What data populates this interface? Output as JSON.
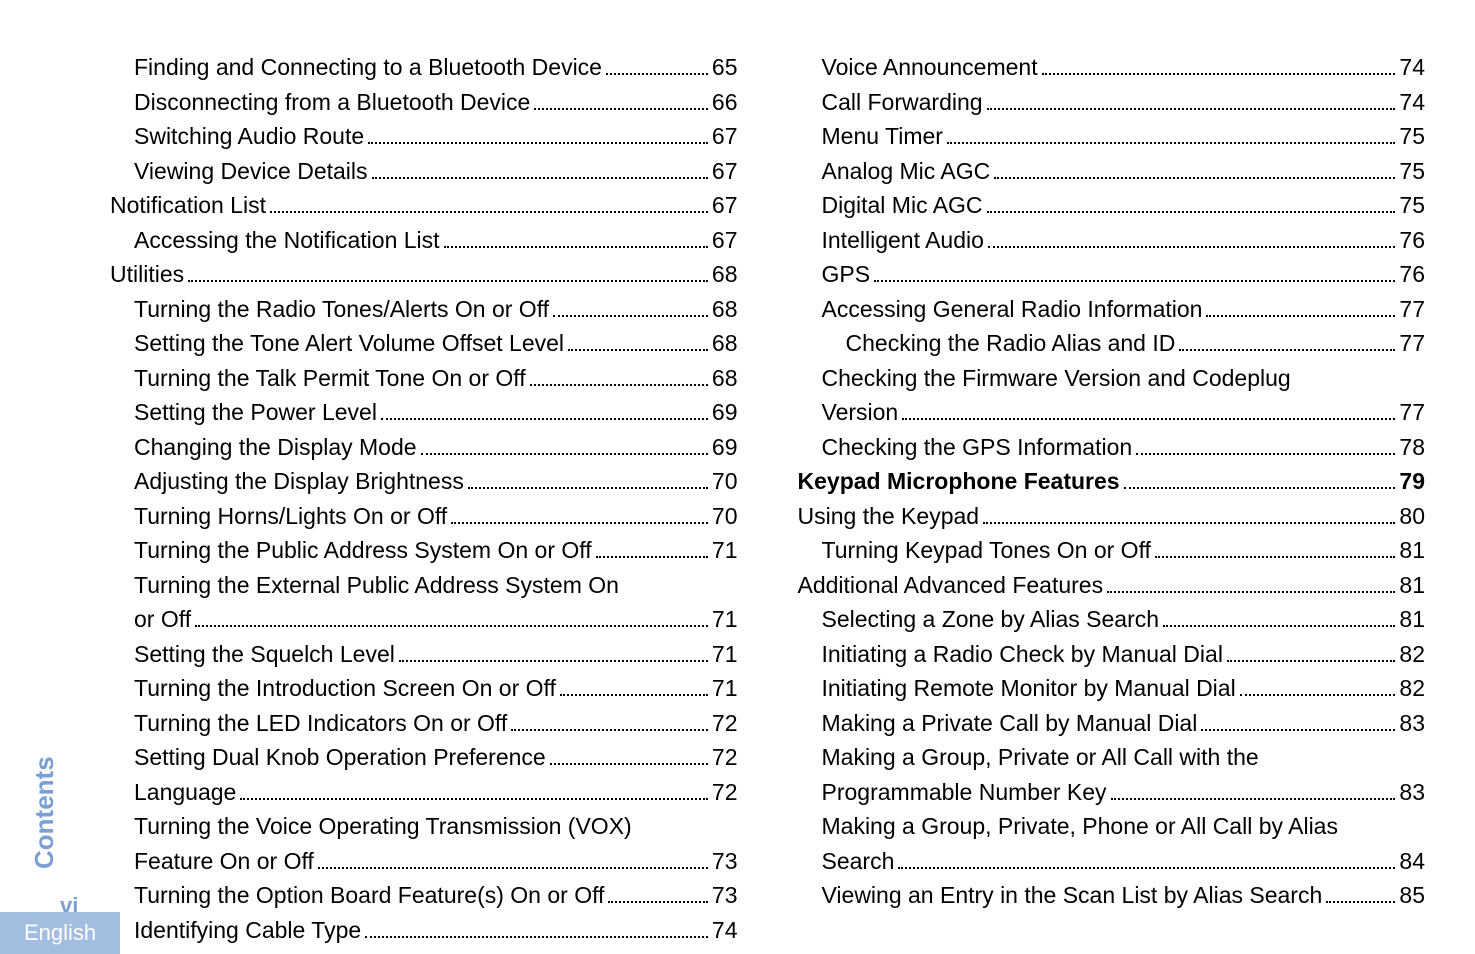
{
  "sidebar_label": "Contents",
  "page_number": "vi",
  "language": "English",
  "left_column": [
    {
      "label": "Finding and Connecting to a Bluetooth Device",
      "page": "65",
      "indent": 1
    },
    {
      "label": "Disconnecting from a Bluetooth Device",
      "page": "66",
      "indent": 1
    },
    {
      "label": "Switching Audio Route",
      "page": "67",
      "indent": 1
    },
    {
      "label": "Viewing Device Details",
      "page": "67",
      "indent": 1
    },
    {
      "label": "Notification List",
      "page": "67",
      "indent": 0
    },
    {
      "label": "Accessing the Notification List",
      "page": "67",
      "indent": 1
    },
    {
      "label": "Utilities",
      "page": "68",
      "indent": 0
    },
    {
      "label": "Turning the Radio Tones/Alerts On or Off",
      "page": "68",
      "indent": 1
    },
    {
      "label": "Setting the Tone Alert Volume Offset Level",
      "page": "68",
      "indent": 1
    },
    {
      "label": "Turning the Talk Permit Tone On or Off",
      "page": "68",
      "indent": 1
    },
    {
      "label": "Setting the Power Level",
      "page": "69",
      "indent": 1
    },
    {
      "label": "Changing the Display Mode",
      "page": "69",
      "indent": 1
    },
    {
      "label": "Adjusting the Display Brightness",
      "page": "70",
      "indent": 1
    },
    {
      "label": "Turning Horns/Lights On or Off",
      "page": "70",
      "indent": 1
    },
    {
      "label": "Turning the Public Address System On or Off",
      "page": "71",
      "indent": 1
    },
    {
      "label_wrap_pre": "Turning the External Public Address System On",
      "label": "or Off",
      "page": "71",
      "indent": 1
    },
    {
      "label": "Setting the Squelch Level",
      "page": "71",
      "indent": 1
    },
    {
      "label": "Turning the Introduction Screen On or Off",
      "page": "71",
      "indent": 1
    },
    {
      "label": "Turning the LED Indicators On or Off",
      "page": "72",
      "indent": 1
    },
    {
      "label": "Setting Dual Knob Operation Preference",
      "page": "72",
      "indent": 1
    },
    {
      "label": "Language",
      "page": "72",
      "indent": 1
    },
    {
      "label_wrap_pre": "Turning the Voice Operating Transmission (VOX)",
      "label": "Feature On or Off",
      "page": "73",
      "indent": 1
    },
    {
      "label": "Turning the Option Board Feature(s) On or Off",
      "page": "73",
      "indent": 1
    },
    {
      "label": "Identifying Cable Type",
      "page": "74",
      "indent": 1
    }
  ],
  "right_column": [
    {
      "label": "Voice Announcement",
      "page": "74",
      "indent": 1
    },
    {
      "label": "Call Forwarding",
      "page": "74",
      "indent": 1
    },
    {
      "label": "Menu Timer",
      "page": "75",
      "indent": 1
    },
    {
      "label": "Analog Mic AGC",
      "page": "75",
      "indent": 1
    },
    {
      "label": "Digital Mic AGC",
      "page": "75",
      "indent": 1
    },
    {
      "label": "Intelligent Audio",
      "page": "76",
      "indent": 1
    },
    {
      "label": "GPS",
      "page": "76",
      "indent": 1
    },
    {
      "label": "Accessing General Radio Information",
      "page": "77",
      "indent": 1
    },
    {
      "label": "Checking the Radio Alias and ID",
      "page": "77",
      "indent": 2
    },
    {
      "label_wrap_pre": "Checking the Firmware Version and Codeplug",
      "label": "Version",
      "page": "77",
      "indent": 1
    },
    {
      "label": "Checking the GPS Information",
      "page": "78",
      "indent": 1
    },
    {
      "label": "Keypad Microphone Features",
      "page": "79",
      "indent": 0,
      "bold": true
    },
    {
      "label": "Using the Keypad",
      "page": "80",
      "indent": 0
    },
    {
      "label": "Turning Keypad Tones On or Off",
      "page": "81",
      "indent": 1
    },
    {
      "label": "Additional Advanced Features",
      "page": "81",
      "indent": 0
    },
    {
      "label": "Selecting a Zone by Alias Search",
      "page": "81",
      "indent": 1
    },
    {
      "label": "Initiating a Radio Check by Manual Dial",
      "page": "82",
      "indent": 1
    },
    {
      "label": "Initiating Remote Monitor by Manual Dial",
      "page": "82",
      "indent": 1
    },
    {
      "label": "Making a Private Call by Manual Dial",
      "page": "83",
      "indent": 1
    },
    {
      "label_wrap_pre": "Making a Group, Private or All Call with the",
      "label": "Programmable Number Key",
      "page": "83",
      "indent": 1
    },
    {
      "label_wrap_pre": "Making a Group, Private, Phone or All Call by Alias",
      "label": "Search",
      "page": "84",
      "indent": 1
    },
    {
      "label": "Viewing an Entry in the Scan List by Alias Search",
      "page": "85",
      "indent": 1
    }
  ]
}
